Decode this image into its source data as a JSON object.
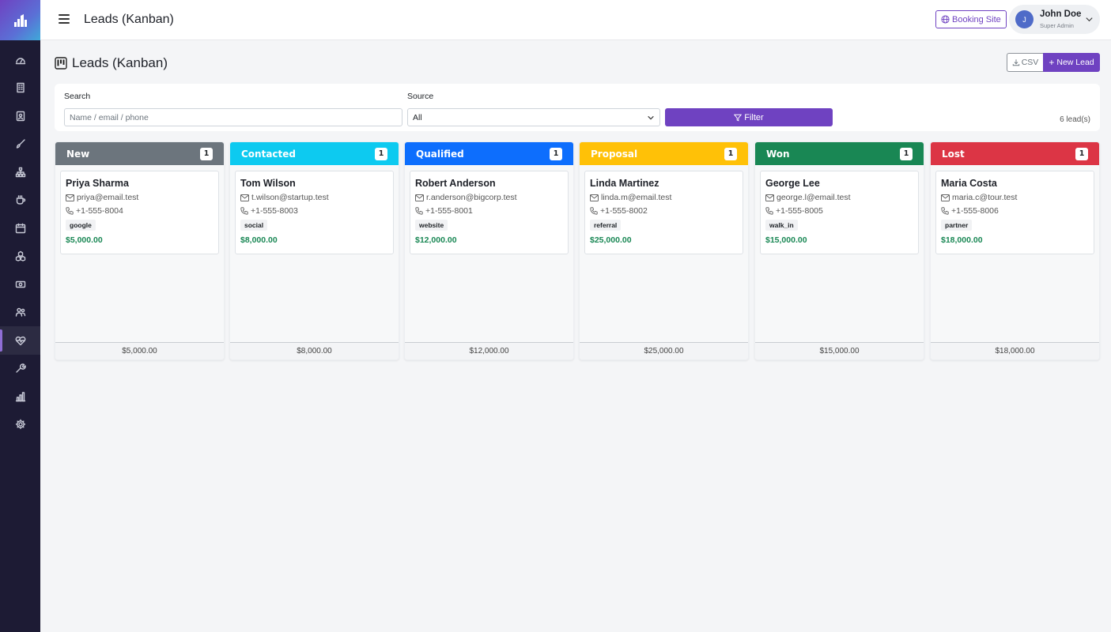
{
  "topbar": {
    "title": "Leads (Kanban)",
    "booking_label": "Booking Site",
    "user": {
      "initial": "J",
      "name": "John Doe",
      "role": "Super Admin"
    }
  },
  "sidebar": {
    "items": [
      {
        "icon": "dashboard-icon"
      },
      {
        "icon": "building-icon"
      },
      {
        "icon": "contact-card-icon"
      },
      {
        "icon": "brush-icon"
      },
      {
        "icon": "sitemap-icon"
      },
      {
        "icon": "cup-icon"
      },
      {
        "icon": "calendar-icon"
      },
      {
        "icon": "boxes-icon"
      },
      {
        "icon": "cash-icon"
      },
      {
        "icon": "people-icon"
      },
      {
        "icon": "heart-pulse-icon",
        "active": true
      },
      {
        "icon": "wrench-icon"
      },
      {
        "icon": "bar-chart-icon"
      },
      {
        "icon": "gear-icon"
      }
    ]
  },
  "page": {
    "title": "Leads (Kanban)",
    "csv_label": "CSV",
    "new_lead_label": "New Lead"
  },
  "filters": {
    "search_label": "Search",
    "search_placeholder": "Name / email / phone",
    "source_label": "Source",
    "source_value": "All",
    "filter_label": "Filter",
    "lead_count": "6 lead(s)"
  },
  "columns": [
    {
      "title": "New",
      "color": "#6c757d",
      "count": "1",
      "total": "$5,000.00",
      "card": {
        "name": "Priya Sharma",
        "email": "priya@email.test",
        "phone": "+1-555-8004",
        "source": "google",
        "value": "$5,000.00"
      }
    },
    {
      "title": "Contacted",
      "color": "#0dcaf0",
      "count": "1",
      "total": "$8,000.00",
      "card": {
        "name": "Tom Wilson",
        "email": "t.wilson@startup.test",
        "phone": "+1-555-8003",
        "source": "social",
        "value": "$8,000.00"
      }
    },
    {
      "title": "Qualified",
      "color": "#0d6efd",
      "count": "1",
      "total": "$12,000.00",
      "card": {
        "name": "Robert Anderson",
        "email": "r.anderson@bigcorp.test",
        "phone": "+1-555-8001",
        "source": "website",
        "value": "$12,000.00"
      }
    },
    {
      "title": "Proposal",
      "color": "#ffc107",
      "count": "1",
      "total": "$25,000.00",
      "card": {
        "name": "Linda Martinez",
        "email": "linda.m@email.test",
        "phone": "+1-555-8002",
        "source": "referral",
        "value": "$25,000.00"
      }
    },
    {
      "title": "Won",
      "color": "#198754",
      "count": "1",
      "total": "$15,000.00",
      "card": {
        "name": "George Lee",
        "email": "george.l@email.test",
        "phone": "+1-555-8005",
        "source": "walk_in",
        "value": "$15,000.00"
      }
    },
    {
      "title": "Lost",
      "color": "#dc3545",
      "count": "1",
      "total": "$18,000.00",
      "card": {
        "name": "Maria Costa",
        "email": "maria.c@tour.test",
        "phone": "+1-555-8006",
        "source": "partner",
        "value": "$18,000.00"
      }
    }
  ]
}
